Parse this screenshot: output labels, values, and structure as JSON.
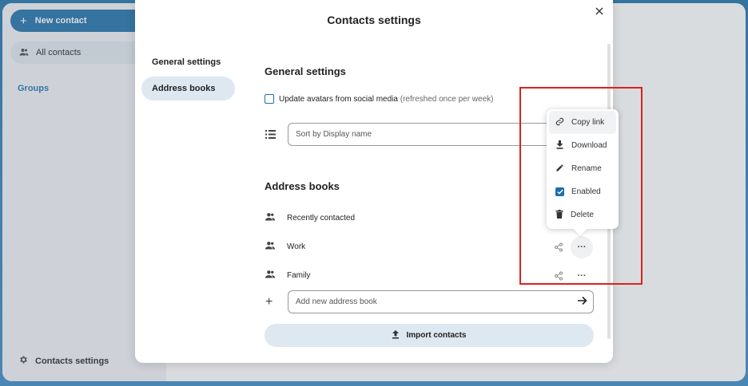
{
  "app": {
    "new_contact": "New contact",
    "all_contacts": "All contacts",
    "groups": "Groups",
    "contacts_settings": "Contacts settings"
  },
  "modal": {
    "title": "Contacts settings",
    "tabs": [
      {
        "label": "General settings"
      },
      {
        "label": "Address books"
      }
    ],
    "general_heading": "General settings",
    "update_avatars_label": "Update avatars from social media",
    "update_avatars_note": "(refreshed once per week)",
    "update_avatars_checked": false,
    "sort_value": "Sort by Display name",
    "address_heading": "Address books",
    "books": [
      {
        "name": "Recently contacted"
      },
      {
        "name": "Work"
      },
      {
        "name": "Family"
      }
    ],
    "add_placeholder": "Add new address book",
    "import_label": "Import contacts"
  },
  "menu": {
    "items": [
      {
        "label": "Copy link",
        "icon": "link-icon"
      },
      {
        "label": "Download",
        "icon": "download-icon"
      },
      {
        "label": "Rename",
        "icon": "pencil-icon"
      },
      {
        "label": "Enabled",
        "icon": "checkbox-checked-icon",
        "checked": true
      },
      {
        "label": "Delete",
        "icon": "trash-icon"
      }
    ]
  },
  "colors": {
    "accent": "#1c6ea8",
    "highlight": "#d9231e",
    "tab_active_bg": "#dde8f1"
  }
}
